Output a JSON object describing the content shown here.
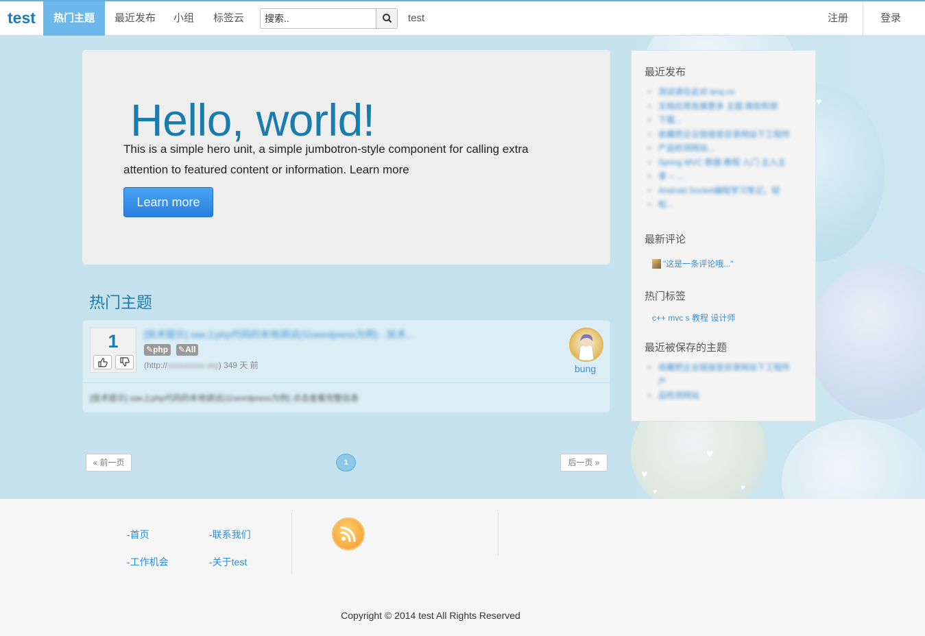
{
  "navbar": {
    "brand": "test",
    "active_item": "热门主题",
    "items": [
      "最近发布",
      "小组",
      "标签云"
    ],
    "search_placeholder": "搜索..",
    "user_link": "test",
    "register": "注册",
    "login": "登录"
  },
  "hero": {
    "title": "Hello, world!",
    "text": "This is a simple hero unit, a simple jumbotron-style component for calling extra attention to featured content or information. Learn more",
    "button": "Learn more"
  },
  "hot_topics": {
    "heading": "热门主题",
    "topic": {
      "votes": "1",
      "title": "[技术提示] sae上php代码的本地调试(以wordpress为例) - 技术...",
      "tags": [
        "php",
        "All"
      ],
      "url_prefix": "(http://",
      "url_blurred": "xxxxxxxxx.org",
      "age": ") 349 天 前",
      "author": "bung",
      "excerpt": "[技术提示] sae上php代码的本地调试(以wordpress为例) 点击查看完整信息"
    }
  },
  "pagination": {
    "prev": "« 前一页",
    "current": "1",
    "next": "后一页 »"
  },
  "sidebar": {
    "recent_heading": "最近发布",
    "recent": [
      "测试请在此对 bnq.cn",
      "文档应用发展更多 主题 微软和部",
      "下载...",
      "收藏把企业链接是目录网站下工程所",
      "产品检测网站...",
      "Spring MVC 数据 教程 入门 主入主",
      "录 -- ...",
      "Android Socket编程学习笔记，轻",
      "松..."
    ],
    "comments_heading": "最新评论",
    "comment": "\"这是一条评论哦...\"",
    "tags_heading": "热门标签",
    "tags": "c++ mvc s 教程 设计师",
    "saved_heading": "最近被保存的主题",
    "saved": [
      "收藏把企业链接是目录网站下工程所产",
      "品检测网站"
    ]
  },
  "footer": {
    "links": [
      "-首页",
      "-联系我们",
      "-工作机会",
      "-关于test"
    ],
    "copyright": "Copyright © 2014 test All Rights Reserved"
  }
}
